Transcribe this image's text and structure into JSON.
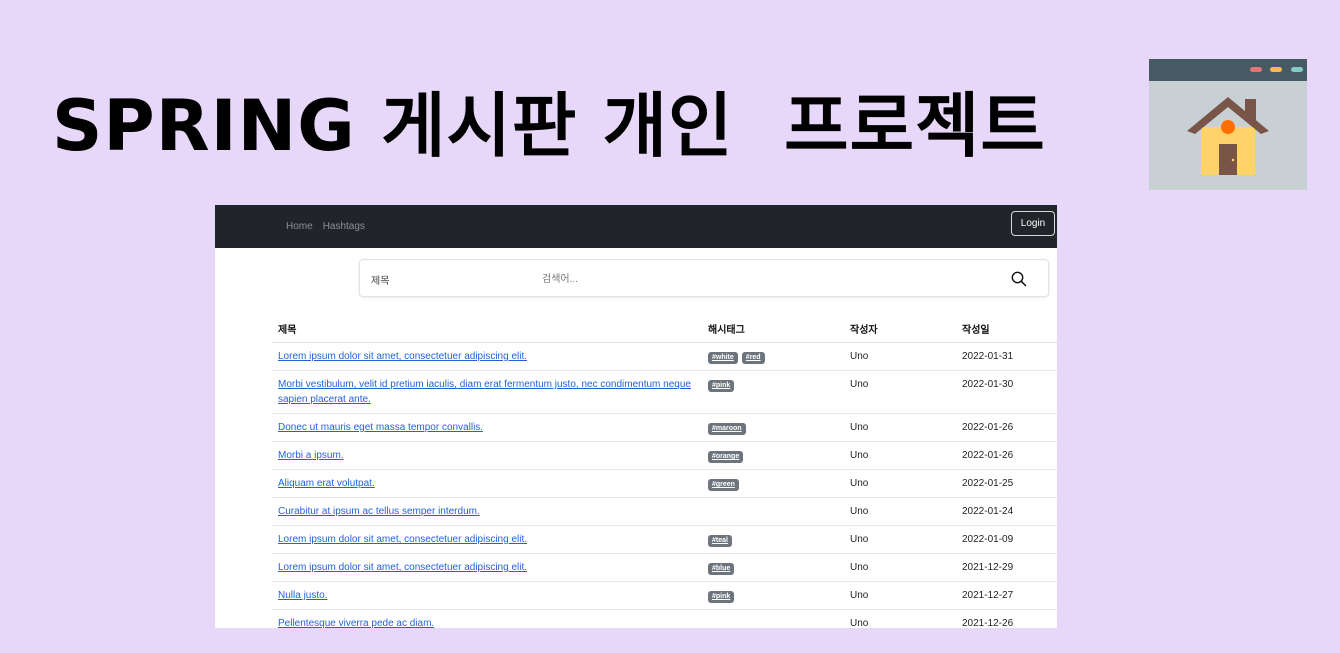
{
  "banner": {
    "title": "SPRING 게시판 개인  프로젝트",
    "icon": "house-browser-icon",
    "colors": {
      "background": "#e7d7f8",
      "browser_bar": "#455a64",
      "browser_body": "#c9d0d3",
      "house_wall": "#ffd369",
      "roof": "#795548",
      "window_dot": "#ff6f00"
    }
  },
  "navbar": {
    "links": [
      "Home",
      "Hashtags"
    ],
    "login_label": "Login"
  },
  "search": {
    "type_label": "제목",
    "placeholder": "검색어...",
    "value": ""
  },
  "table": {
    "headers": [
      "제목",
      "해시태그",
      "작성자",
      "작성일"
    ],
    "rows": [
      {
        "title": "Lorem ipsum dolor sit amet, consectetuer adipiscing elit.",
        "tags": [
          "#white",
          "#red"
        ],
        "author": "Uno",
        "date": "2022-01-31"
      },
      {
        "title": "Morbi vestibulum, velit id pretium iaculis, diam erat fermentum justo, nec condimentum neque sapien placerat ante.",
        "tags": [
          "#pink"
        ],
        "author": "Uno",
        "date": "2022-01-30"
      },
      {
        "title": "Donec ut mauris eget massa tempor convallis.",
        "tags": [
          "#maroon"
        ],
        "author": "Uno",
        "date": "2022-01-26"
      },
      {
        "title": "Morbi a ipsum.",
        "tags": [
          "#orange"
        ],
        "author": "Uno",
        "date": "2022-01-26"
      },
      {
        "title": "Aliquam erat volutpat.",
        "tags": [
          "#green"
        ],
        "author": "Uno",
        "date": "2022-01-25"
      },
      {
        "title": "Curabitur at ipsum ac tellus semper interdum.",
        "tags": [],
        "author": "Uno",
        "date": "2022-01-24"
      },
      {
        "title": "Lorem ipsum dolor sit amet, consectetuer adipiscing elit.",
        "tags": [
          "#teal"
        ],
        "author": "Uno",
        "date": "2022-01-09"
      },
      {
        "title": "Lorem ipsum dolor sit amet, consectetuer adipiscing elit.",
        "tags": [
          "#blue"
        ],
        "author": "Uno",
        "date": "2021-12-29"
      },
      {
        "title": "Nulla justo.",
        "tags": [
          "#pink"
        ],
        "author": "Uno",
        "date": "2021-12-27"
      },
      {
        "title": "Pellentesque viverra pede ac diam.",
        "tags": [],
        "author": "Uno",
        "date": "2021-12-26"
      }
    ]
  }
}
